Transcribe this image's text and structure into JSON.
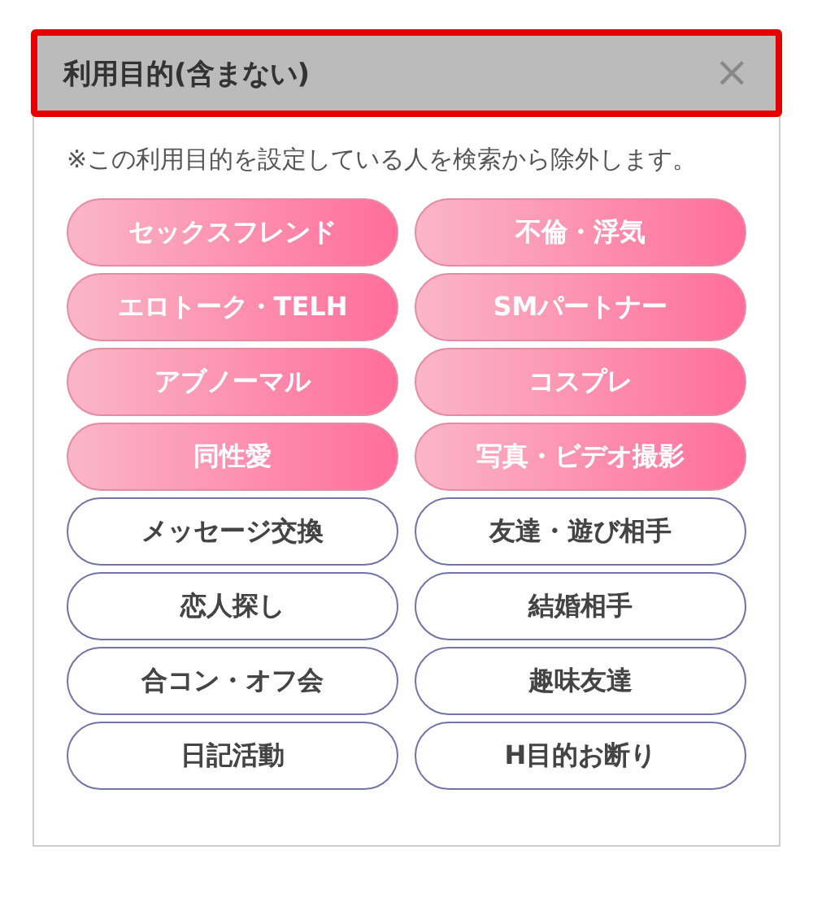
{
  "dialog": {
    "title": "利用目的(含まない)",
    "close": "×",
    "highlighted": true,
    "note": "※この利用目的を設定している人を検索から除外します。",
    "options": [
      {
        "label": "セックスフレンド",
        "selected": true
      },
      {
        "label": "不倫・浮気",
        "selected": true
      },
      {
        "label": "エロトーク・TELH",
        "selected": true
      },
      {
        "label": "SMパートナー",
        "selected": true
      },
      {
        "label": "アブノーマル",
        "selected": true
      },
      {
        "label": "コスプレ",
        "selected": true
      },
      {
        "label": "同性愛",
        "selected": true
      },
      {
        "label": "写真・ビデオ撮影",
        "selected": true
      },
      {
        "label": "メッセージ交換",
        "selected": false
      },
      {
        "label": "友達・遊び相手",
        "selected": false
      },
      {
        "label": "恋人探し",
        "selected": false
      },
      {
        "label": "結婚相手",
        "selected": false
      },
      {
        "label": "合コン・オフ会",
        "selected": false
      },
      {
        "label": "趣味友達",
        "selected": false
      },
      {
        "label": "日記活動",
        "selected": false
      },
      {
        "label": "H目的お断り",
        "selected": false
      }
    ]
  }
}
